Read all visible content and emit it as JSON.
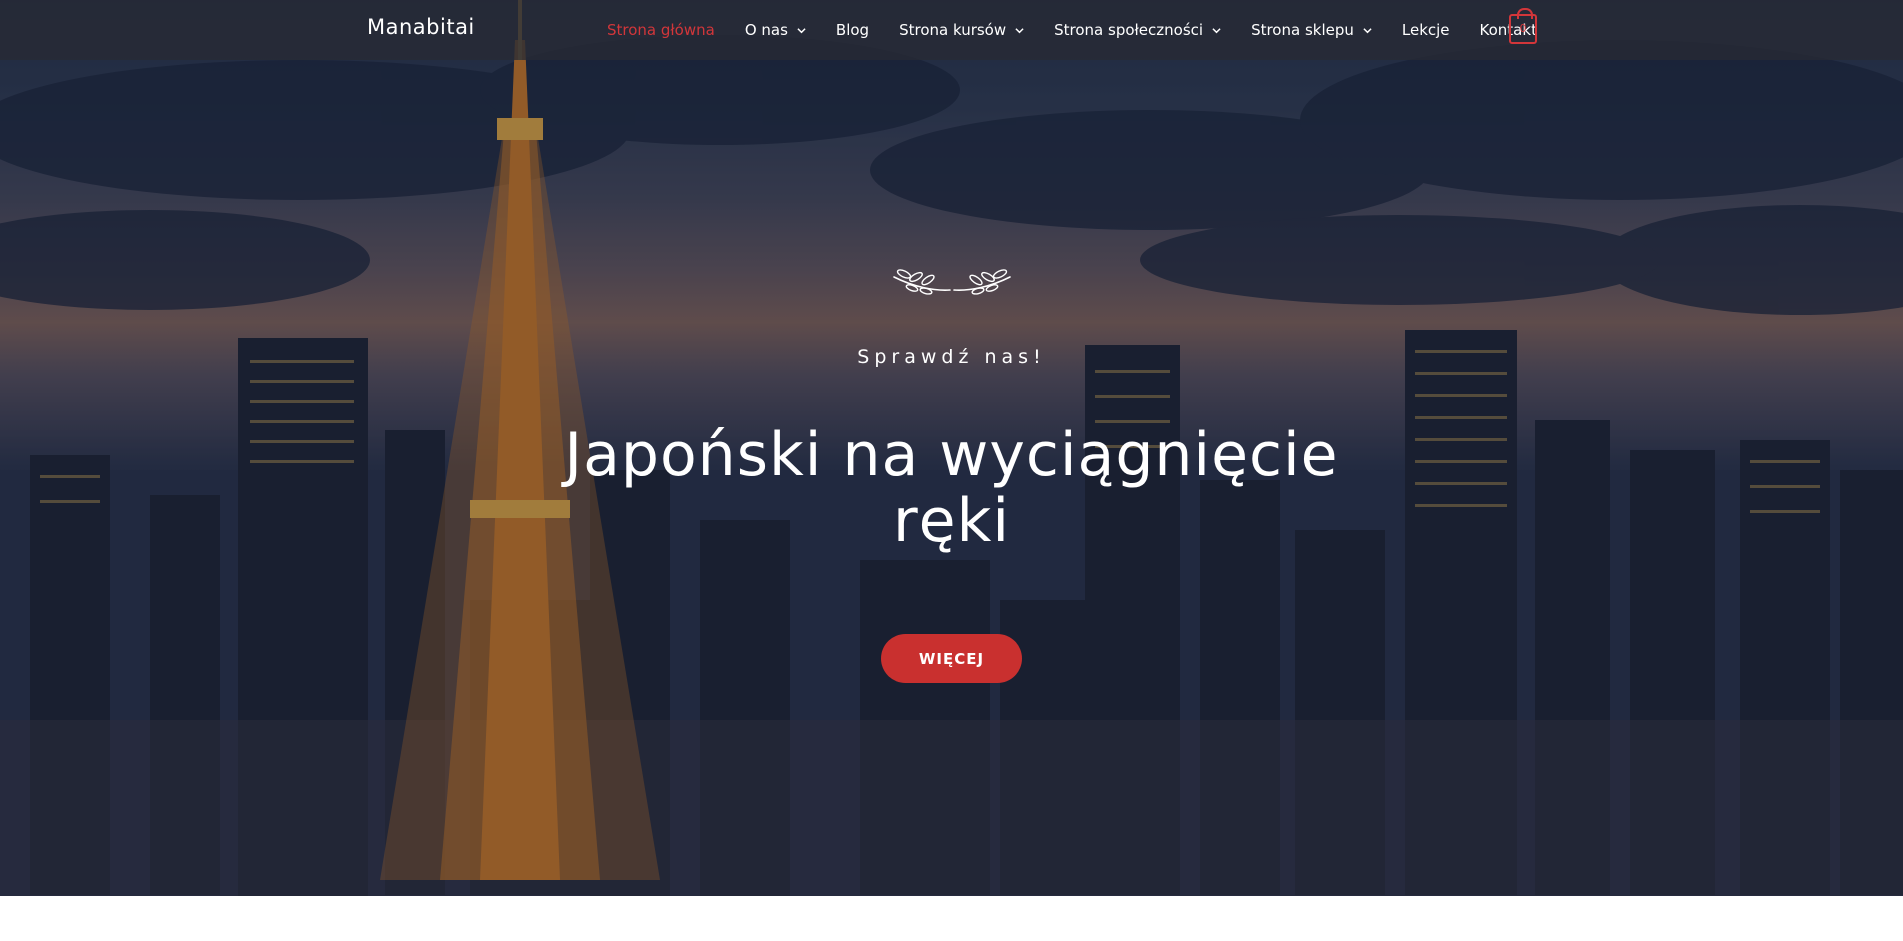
{
  "site": {
    "logo": "Manabitai"
  },
  "nav": {
    "items": [
      {
        "label": "Strona główna",
        "active": true,
        "has_dropdown": false
      },
      {
        "label": "O nas",
        "active": false,
        "has_dropdown": true
      },
      {
        "label": "Blog",
        "active": false,
        "has_dropdown": false
      },
      {
        "label": "Strona kursów",
        "active": false,
        "has_dropdown": true
      },
      {
        "label": "Strona społeczności",
        "active": false,
        "has_dropdown": true
      },
      {
        "label": "Strona sklepu",
        "active": false,
        "has_dropdown": true
      },
      {
        "label": "Lekcje",
        "active": false,
        "has_dropdown": false
      },
      {
        "label": "Kontakt",
        "active": false,
        "has_dropdown": false
      }
    ],
    "cart": {
      "icon": "shopping-bag-icon",
      "count": "0"
    }
  },
  "hero": {
    "ornament_icon": "laurel-icon",
    "eyebrow": "Sprawdź nas!",
    "headline": "Japoński na wyciągnięcie ręki",
    "button_label": "WIĘCEJ"
  },
  "colors": {
    "accent": "#d2363a",
    "button": "#c9302f",
    "navbar_bg": "#2a2c34",
    "text": "#ffffff"
  }
}
